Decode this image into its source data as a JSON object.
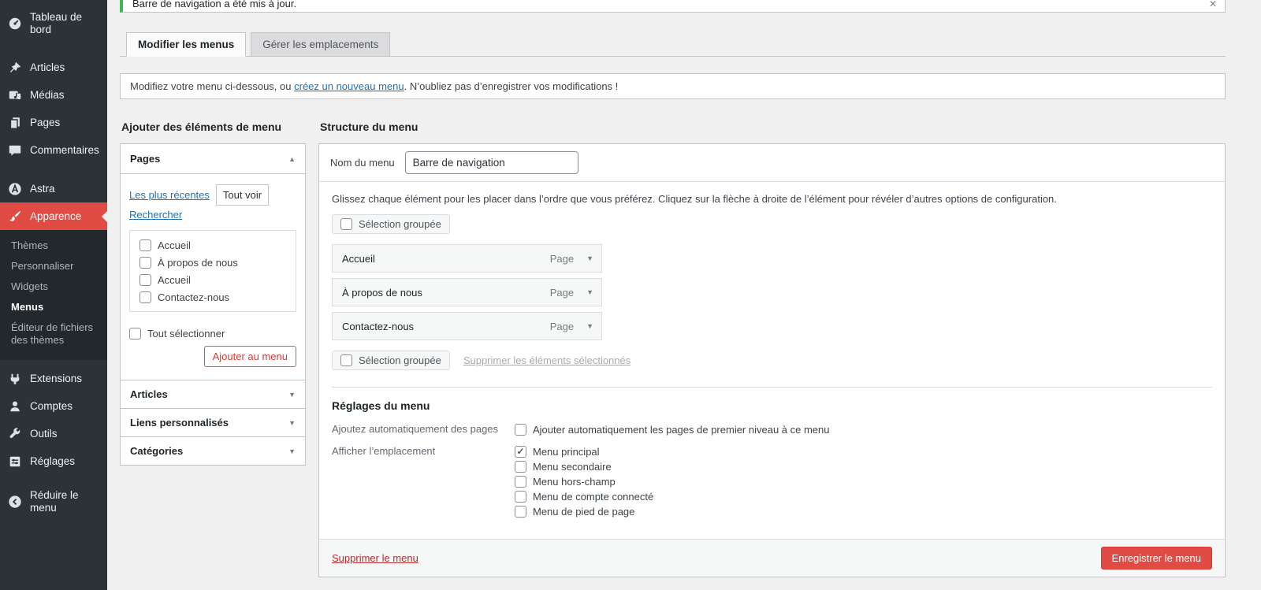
{
  "colors": {
    "accent_red": "#e04b43",
    "success_green": "#46b450",
    "link_blue": "#2271b1"
  },
  "sidebar": {
    "items": {
      "dashboard": "Tableau de bord",
      "posts": "Articles",
      "media": "Médias",
      "pages": "Pages",
      "comments": "Commentaires",
      "astra": "Astra",
      "appearance": "Apparence",
      "plugins": "Extensions",
      "users": "Comptes",
      "tools": "Outils",
      "settings": "Réglages",
      "collapse": "Réduire le menu"
    },
    "appearance_submenu": [
      "Thèmes",
      "Personnaliser",
      "Widgets",
      "Menus",
      "Éditeur de fichiers des thèmes"
    ],
    "current_submenu": "Menus"
  },
  "notice": {
    "text": "Barre de navigation a été mis à jour.",
    "dismiss": "✕"
  },
  "tabs": {
    "edit": "Modifier les menus",
    "locations": "Gérer les emplacements"
  },
  "intro": {
    "before": "Modifiez votre menu ci-dessous, ou ",
    "link": "créez un nouveau menu",
    "after": ". N’oubliez pas d’enregistrer vos modifications !"
  },
  "left": {
    "title": "Ajouter des éléments de menu",
    "pages_panel": {
      "title": "Pages",
      "tab_recent": "Les plus récentes",
      "tab_all": "Tout voir",
      "tab_search": "Rechercher",
      "items": [
        "Accueil",
        "À propos de nous",
        "Accueil",
        "Contactez-nous"
      ],
      "select_all": "Tout sélectionner",
      "add_button": "Ajouter au menu"
    },
    "accordions": [
      "Articles",
      "Liens personnalisés",
      "Catégories"
    ]
  },
  "right": {
    "title": "Structure du menu",
    "name_label": "Nom du menu",
    "name_value": "Barre de navigation",
    "instructions": "Glissez chaque élément pour les placer dans l’ordre que vous préférez. Cliquez sur la flèche à droite de l’élément pour révéler d’autres options de configuration.",
    "bulk_select": "Sélection groupée",
    "menu_items": [
      {
        "label": "Accueil",
        "type": "Page"
      },
      {
        "label": "À propos de nous",
        "type": "Page"
      },
      {
        "label": "Contactez-nous",
        "type": "Page"
      }
    ],
    "remove_selected": "Supprimer les éléments sélectionnés",
    "settings": {
      "title": "Réglages du menu",
      "auto_add_label": "Ajoutez automatiquement des pages",
      "auto_add_option": "Ajouter automatiquement les pages de premier niveau à ce menu",
      "display_label": "Afficher l’emplacement",
      "locations": [
        {
          "label": "Menu principal",
          "checked": true
        },
        {
          "label": "Menu secondaire",
          "checked": false
        },
        {
          "label": "Menu hors-champ",
          "checked": false
        },
        {
          "label": "Menu de compte connecté",
          "checked": false
        },
        {
          "label": "Menu de pied de page",
          "checked": false
        }
      ]
    },
    "footer": {
      "delete": "Supprimer le menu",
      "save": "Enregistrer le menu"
    }
  }
}
